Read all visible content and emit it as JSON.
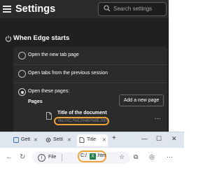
{
  "settings": {
    "title": "Settings",
    "search_placeholder": "Search settings",
    "section_title": "When Edge starts",
    "options": [
      {
        "label": "Open the new tab page",
        "selected": false
      },
      {
        "label": "Open tabs from the previous session",
        "selected": false
      },
      {
        "label": "Open these pages:",
        "selected": true
      }
    ],
    "pages_label": "Pages",
    "add_page_button": "Add a new page",
    "entry": {
      "title": "Title of the document",
      "url": "file:///C:/%E2%80%8E.htm"
    },
    "more_glyph": "..."
  },
  "browser": {
    "tabs": [
      {
        "label": "Gett",
        "icon": "edge-tab-icon",
        "active": false
      },
      {
        "label": "Setti",
        "icon": "gear-icon",
        "active": false
      },
      {
        "label": "Title",
        "icon": "document-icon",
        "active": true
      }
    ],
    "new_tab_glyph": "+",
    "address": {
      "info_glyph": "i",
      "scheme_label": "File",
      "path_prefix": "C:/",
      "path_suffix": ".htm",
      "highlight_color": "#f0a23a"
    }
  },
  "accent_color": "#f0a23a"
}
